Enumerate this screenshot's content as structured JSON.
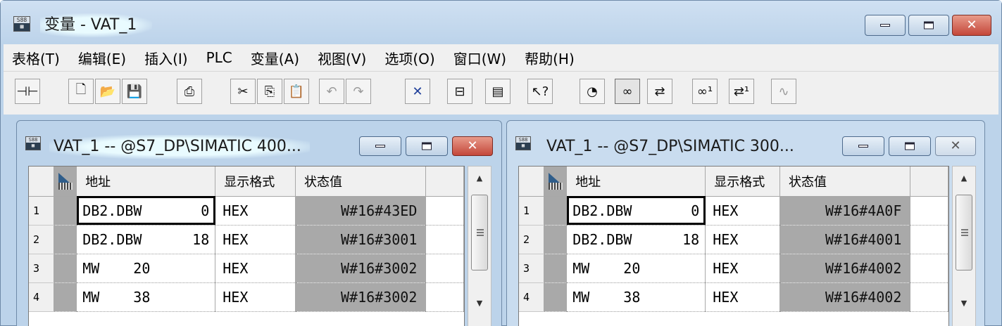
{
  "app": {
    "title": "变量 - VAT_1",
    "icon_name": "s7-vat-icon",
    "icon_text": "S88"
  },
  "menu": [
    "表格(T)",
    "编辑(E)",
    "插入(I)",
    "PLC",
    "变量(A)",
    "视图(V)",
    "选项(O)",
    "窗口(W)",
    "帮助(H)"
  ],
  "toolbar": [
    {
      "icon": "pin-icon",
      "glyph": "⊣⊢"
    },
    {
      "icon": "new-icon",
      "glyph": "🗋"
    },
    {
      "icon": "open-icon",
      "glyph": "📂"
    },
    {
      "icon": "save-icon",
      "glyph": "💾"
    },
    {
      "icon": "print-icon",
      "glyph": "⎙"
    },
    {
      "icon": "cut-icon",
      "glyph": "✂"
    },
    {
      "icon": "copy-icon",
      "glyph": "⎘"
    },
    {
      "icon": "paste-icon",
      "glyph": "📋"
    },
    {
      "icon": "undo-icon",
      "glyph": "↶"
    },
    {
      "icon": "redo-icon",
      "glyph": "↷"
    },
    {
      "icon": "delete-icon",
      "glyph": "✕"
    },
    {
      "icon": "accessible-nodes-icon",
      "glyph": "⊟"
    },
    {
      "icon": "plc-online-icon",
      "glyph": "▤"
    },
    {
      "icon": "help-pointer-icon",
      "glyph": "↖?"
    },
    {
      "icon": "monitor-icon",
      "glyph": "◔"
    },
    {
      "icon": "monitor-glasses-icon",
      "glyph": "∞"
    },
    {
      "icon": "modify-icon",
      "glyph": "⇄"
    },
    {
      "icon": "update-monitor-icon",
      "glyph": "∞¹"
    },
    {
      "icon": "activate-modify-icon",
      "glyph": "⇄¹"
    },
    {
      "icon": "trigger-icon",
      "glyph": "∿"
    }
  ],
  "windows": [
    {
      "title": "VAT_1 -- @S7_DP\\SIMATIC 400...",
      "active": true,
      "headers": {
        "addr": "地址",
        "fmt": "显示格式",
        "val": "状态值"
      },
      "rows": [
        {
          "num": "1",
          "op": "DB2.DBW",
          "n": "0",
          "fmt": "HEX",
          "val": "W#16#43ED"
        },
        {
          "num": "2",
          "op": "DB2.DBW",
          "n": "18",
          "fmt": "HEX",
          "val": "W#16#3001"
        },
        {
          "num": "3",
          "op": "MW",
          "n": "20",
          "fmt": "HEX",
          "val": "W#16#3002"
        },
        {
          "num": "4",
          "op": "MW",
          "n": "38",
          "fmt": "HEX",
          "val": "W#16#3002"
        }
      ]
    },
    {
      "title": "VAT_1 -- @S7_DP\\SIMATIC 300...",
      "active": false,
      "headers": {
        "addr": "地址",
        "fmt": "显示格式",
        "val": "状态值"
      },
      "rows": [
        {
          "num": "1",
          "op": "DB2.DBW",
          "n": "0",
          "fmt": "HEX",
          "val": "W#16#4A0F"
        },
        {
          "num": "2",
          "op": "DB2.DBW",
          "n": "18",
          "fmt": "HEX",
          "val": "W#16#4001"
        },
        {
          "num": "3",
          "op": "MW",
          "n": "20",
          "fmt": "HEX",
          "val": "W#16#4002"
        },
        {
          "num": "4",
          "op": "MW",
          "n": "38",
          "fmt": "HEX",
          "val": "W#16#4002"
        }
      ]
    }
  ]
}
